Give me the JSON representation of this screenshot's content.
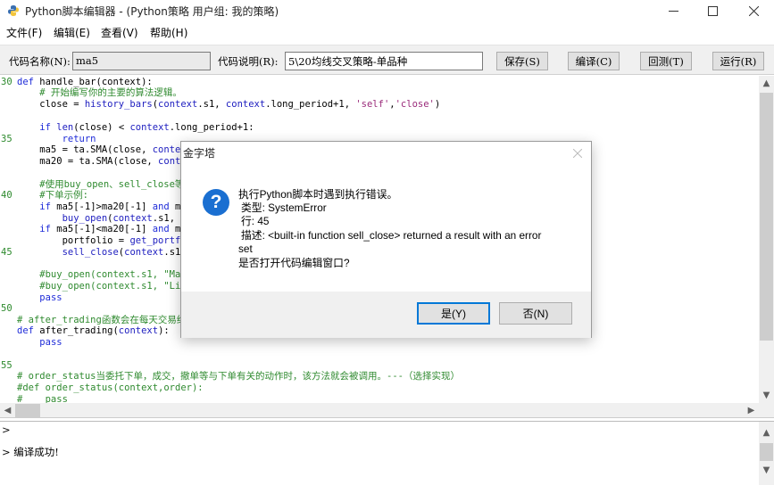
{
  "window": {
    "title": "Python脚本编辑器 - (Python策略 用户组: 我的策略)"
  },
  "menu": [
    "文件(F)",
    "编辑(E)",
    "查看(V)",
    "帮助(H)"
  ],
  "toolbar": {
    "code_name_label": "代码名称(N):",
    "code_name_value": "ma5",
    "code_desc_label": "代码说明(R):",
    "code_desc_value": "5\\20均线交叉策略-单品种",
    "save_label": "保存(S)",
    "compile_label": "编译(C)",
    "backtest_label": "回测(T)",
    "run_label": "运行(R)"
  },
  "editor": {
    "line_numbers": [
      "30",
      "35",
      "40",
      "45",
      "50",
      "55"
    ]
  },
  "output": {
    "prompt1": ">",
    "line2": "> 编译成功!"
  },
  "dialog": {
    "title": "金字塔",
    "line1": "执行Python脚本时遇到执行错误。",
    "line2": "类型: SystemError",
    "line3": "行:  45",
    "line4": "描述: <built-in function sell_close> returned a result with an error",
    "line5": "set",
    "line6": "是否打开代码编辑窗口?",
    "yes_label": "是(Y)",
    "no_label": "否(N)"
  },
  "icons": {
    "app": "python-icon",
    "question": "question-icon"
  },
  "colors": {
    "keyword": "#1e2bd8",
    "comment": "#2f8a2f",
    "string": "#9a2a7a",
    "accent": "#0078d7"
  }
}
